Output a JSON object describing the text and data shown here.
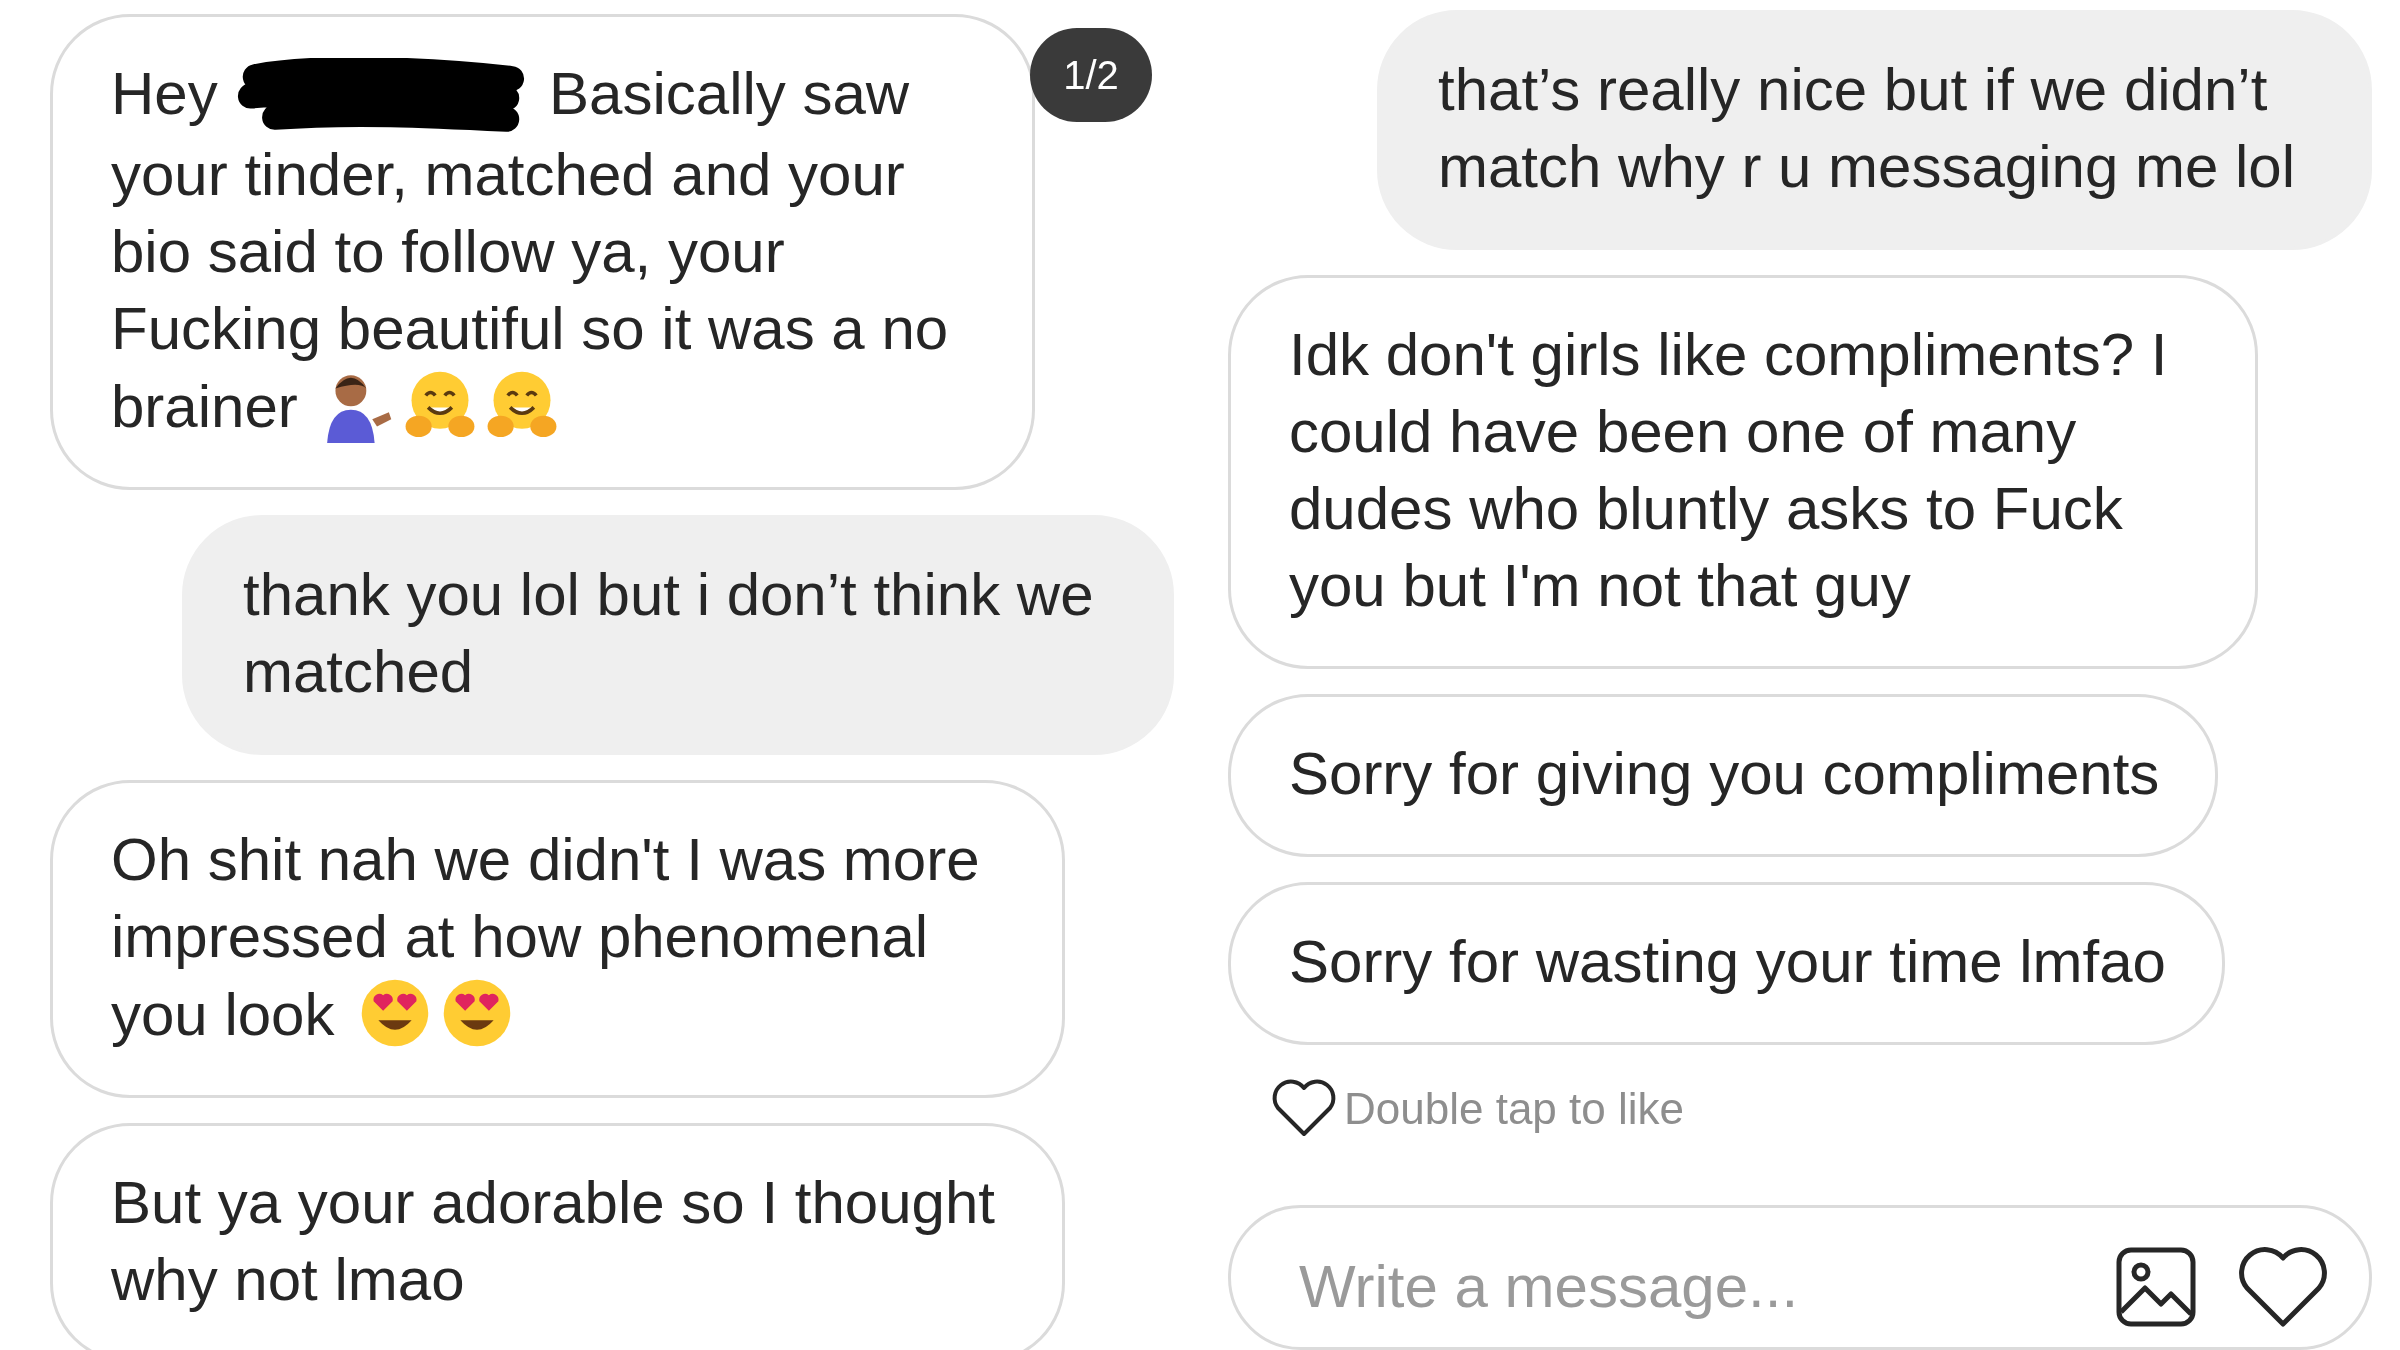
{
  "panels": [
    {
      "badge": "1/2",
      "messages": [
        {
          "kind": "received",
          "parts": [
            {
              "kind": "phrase",
              "text": "Hey"
            },
            {
              "kind": "redaction"
            },
            {
              "kind": "phrase",
              "text": "Basically saw"
            },
            {
              "kind": "new_line",
              "text": "your tinder, matched and your bio said to follow ya, your Fucking beautiful so it was a no"
            },
            {
              "kind": "new_line",
              "text": "brainer"
            },
            {
              "kind": "person_emoji"
            },
            {
              "kind": "hug_emoji"
            },
            {
              "kind": "hug_emoji"
            }
          ]
        },
        {
          "kind": "sent",
          "parts": [
            {
              "kind": "text",
              "text": "thank you lol but i don’t think we matched"
            }
          ]
        },
        {
          "kind": "received",
          "parts": [
            {
              "kind": "text",
              "text": "Oh shit nah we didn't I was more impressed at how phenomenal"
            },
            {
              "kind": "new_line",
              "text": "you look"
            },
            {
              "kind": "heart_eyes_emoji"
            },
            {
              "kind": "heart_eyes_emoji"
            }
          ]
        },
        {
          "kind": "received",
          "parts": [
            {
              "kind": "text",
              "text": "But ya your adorable so I thought why not lmao"
            }
          ]
        }
      ]
    },
    {
      "messages": [
        {
          "kind": "sent",
          "parts": [
            {
              "kind": "text",
              "text": "that’s really nice but if we didn’t match why r u messaging me lol"
            }
          ]
        },
        {
          "kind": "received",
          "parts": [
            {
              "kind": "text",
              "text": "Idk don't girls like compliments? I could have been one of many dudes who bluntly asks to Fuck you but I'm not that guy"
            }
          ]
        },
        {
          "kind": "received",
          "parts": [
            {
              "kind": "text",
              "text": "Sorry for giving you compliments"
            }
          ]
        },
        {
          "kind": "received",
          "parts": [
            {
              "kind": "text",
              "text": "Sorry for wasting your time lmfao"
            }
          ]
        }
      ],
      "like_hint": "Double tap to like",
      "composer": {
        "placeholder": "Write a message..."
      }
    }
  ]
}
